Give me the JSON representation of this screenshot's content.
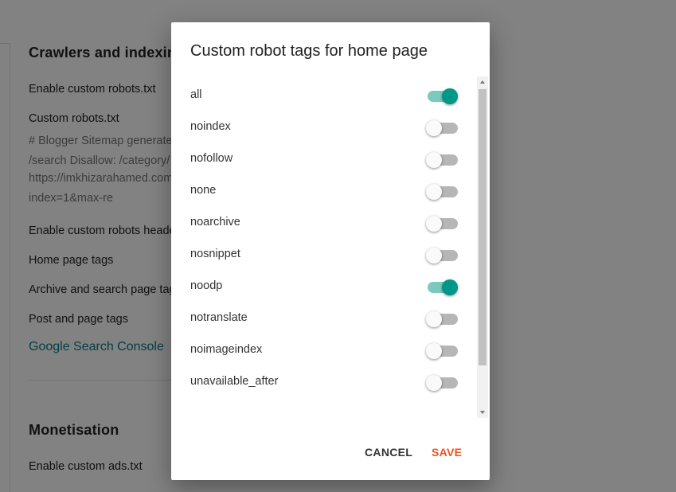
{
  "background": {
    "section1_title": "Crawlers and indexing",
    "rows": [
      "Enable custom robots.txt",
      "Custom robots.txt",
      "Enable custom robots header tags",
      "Home page tags",
      "Archive and search page tags",
      "Post and page tags"
    ],
    "code_lines": [
      "# Blogger Sitemap generated",
      "/search Disallow: /category/",
      "https://imkhizarahamed.com",
      "index=1&max-re"
    ],
    "console_link": "Google Search Console",
    "section2_title": "Monetisation",
    "ads_row": "Enable custom ads.txt"
  },
  "dialog": {
    "title": "Custom robot tags for home page",
    "options": [
      {
        "label": "all",
        "enabled": true
      },
      {
        "label": "noindex",
        "enabled": false
      },
      {
        "label": "nofollow",
        "enabled": false
      },
      {
        "label": "none",
        "enabled": false
      },
      {
        "label": "noarchive",
        "enabled": false
      },
      {
        "label": "nosnippet",
        "enabled": false
      },
      {
        "label": "noodp",
        "enabled": true
      },
      {
        "label": "notranslate",
        "enabled": false
      },
      {
        "label": "noimageindex",
        "enabled": false
      },
      {
        "label": "unavailable_after",
        "enabled": false
      }
    ],
    "cancel_label": "CANCEL",
    "save_label": "SAVE"
  },
  "colors": {
    "accent_teal": "#009688",
    "save_orange": "#f4511e",
    "link_teal": "#0b7a84"
  }
}
